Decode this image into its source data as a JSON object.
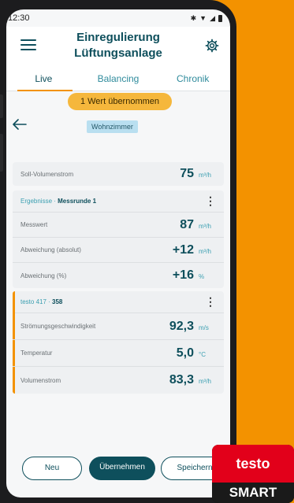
{
  "status": {
    "time": "12:30"
  },
  "header": {
    "title_line1": "Einregulierung",
    "title_line2": "Lüftungsanlage"
  },
  "tabs": [
    "Live",
    "Balancing",
    "Chronik"
  ],
  "notice": {
    "label": "1 Wert übernommen"
  },
  "room": {
    "label": "Wohnzimmer"
  },
  "target": {
    "label": "Soll-Volumenstrom",
    "value": "75",
    "unit": "m³/h"
  },
  "results": {
    "heading_prefix": "Ergebnisse · ",
    "heading_bold": "Messrunde 1",
    "rows": [
      {
        "label": "Messwert",
        "value": "87",
        "unit": "m³/h"
      },
      {
        "label": "Abweichung (absolut)",
        "value": "+12",
        "unit": "m³/h"
      },
      {
        "label": "Abweichung (%)",
        "value": "+16",
        "unit": "%"
      }
    ]
  },
  "probe": {
    "heading_prefix": "testo 417 · ",
    "heading_bold": "358",
    "rows": [
      {
        "label": "Strömungsgeschwindigkeit",
        "value": "92,3",
        "unit": "m/s"
      },
      {
        "label": "Temperatur",
        "value": "5,0",
        "unit": "°C"
      },
      {
        "label": "Volumenstrom",
        "value": "83,3",
        "unit": "m³/h"
      }
    ]
  },
  "buttons": {
    "new": "Neu",
    "apply": "Übernehmen",
    "save": "Speichern"
  },
  "logo": {
    "word": "testo",
    "bottom": "SMART"
  }
}
